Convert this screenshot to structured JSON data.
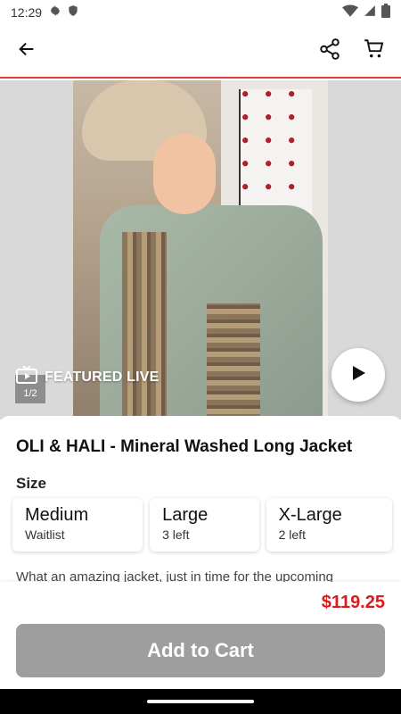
{
  "status_bar": {
    "time": "12:29",
    "left_icons": [
      "gear-icon",
      "shield-icon"
    ],
    "right_icons": [
      "wifi-icon",
      "signal-icon",
      "battery-icon"
    ]
  },
  "app_bar": {
    "back_icon": "arrow-left-icon",
    "share_icon": "share-icon",
    "cart_icon": "cart-icon",
    "accent_color": "#e23b3b"
  },
  "media": {
    "featured_label": "FEATURED LIVE",
    "counter": "1/2",
    "play_icon": "play-icon"
  },
  "product": {
    "title": "OLI & HALI - Mineral Washed Long Jacket",
    "size_label": "Size",
    "sizes": [
      {
        "name": "Medium",
        "availability": "Waitlist"
      },
      {
        "name": "Large",
        "availability": "3 left"
      },
      {
        "name": "X-Large",
        "availability": "2 left"
      }
    ],
    "description": "What an amazing jacket, just in time for the upcoming"
  },
  "checkout": {
    "price": "$119.25",
    "price_color": "#d81b1b",
    "add_to_cart_label": "Add to Cart"
  }
}
